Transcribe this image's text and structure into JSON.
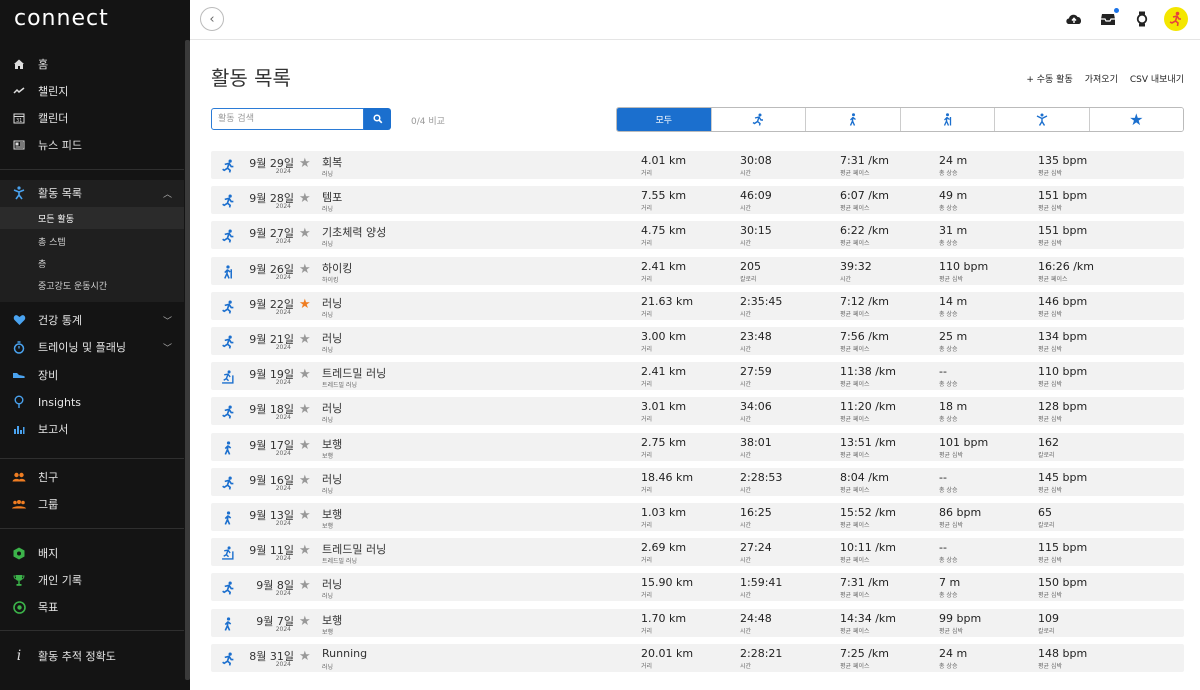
{
  "app": {
    "logo": "connect"
  },
  "sidebar": {
    "items": [
      {
        "label": "홈",
        "icon": "home-icon"
      },
      {
        "label": "챌린지",
        "icon": "challenge-icon"
      },
      {
        "label": "캘린더",
        "icon": "calendar-icon"
      },
      {
        "label": "뉴스 피드",
        "icon": "news-feed-icon"
      },
      {
        "label": "활동 목록",
        "icon": "activity-icon"
      },
      {
        "label": "건강 통계",
        "icon": "heart-icon"
      },
      {
        "label": "트레이닝 및 플래닝",
        "icon": "stopwatch-icon"
      },
      {
        "label": "장비",
        "icon": "shoe-icon"
      },
      {
        "label": "Insights",
        "icon": "lightbulb-icon"
      },
      {
        "label": "보고서",
        "icon": "report-icon"
      },
      {
        "label": "친구",
        "icon": "friends-icon"
      },
      {
        "label": "그룹",
        "icon": "groups-icon"
      },
      {
        "label": "배지",
        "icon": "badge-icon"
      },
      {
        "label": "개인 기록",
        "icon": "trophy-icon"
      },
      {
        "label": "목표",
        "icon": "goal-icon"
      },
      {
        "label": "활동 추적 정확도",
        "icon": "info-icon"
      }
    ],
    "subitems": [
      "모든 활동",
      "총 스텝",
      "층",
      "중고강도 운동시간"
    ]
  },
  "page": {
    "title": "활동 목록",
    "actions": [
      "+ 수동 활동",
      "가져오기",
      "CSV 내보내기"
    ],
    "search_placeholder": "활동 검색",
    "compare": "0/4 비교",
    "filters": [
      "모두",
      "",
      "",
      "",
      "",
      ""
    ]
  },
  "accent": "#1b6fce",
  "activities": [
    {
      "icon": "run",
      "date": "9월 29일",
      "year": "2024",
      "fav": false,
      "name": "회복",
      "type": "러닝",
      "stats": [
        [
          "4.01 km",
          "거리"
        ],
        [
          "30:08",
          "시간"
        ],
        [
          "7:31 /km",
          "평균 페이스"
        ],
        [
          "24 m",
          "총 상승"
        ],
        [
          "135 bpm",
          "평균 심박"
        ]
      ]
    },
    {
      "icon": "run",
      "date": "9월 28일",
      "year": "2024",
      "fav": false,
      "name": "템포",
      "type": "러닝",
      "stats": [
        [
          "7.55 km",
          "거리"
        ],
        [
          "46:09",
          "시간"
        ],
        [
          "6:07 /km",
          "평균 페이스"
        ],
        [
          "49 m",
          "총 상승"
        ],
        [
          "151 bpm",
          "평균 심박"
        ]
      ]
    },
    {
      "icon": "run",
      "date": "9월 27일",
      "year": "2024",
      "fav": false,
      "name": "기초체력 양성",
      "type": "러닝",
      "stats": [
        [
          "4.75 km",
          "거리"
        ],
        [
          "30:15",
          "시간"
        ],
        [
          "6:22 /km",
          "평균 페이스"
        ],
        [
          "31 m",
          "총 상승"
        ],
        [
          "151 bpm",
          "평균 심박"
        ]
      ]
    },
    {
      "icon": "hike",
      "date": "9월 26일",
      "year": "2024",
      "fav": false,
      "name": "하이킹",
      "type": "하이킹",
      "stats": [
        [
          "2.41 km",
          "거리"
        ],
        [
          "205",
          "칼로리"
        ],
        [
          "39:32",
          "시간"
        ],
        [
          "110 bpm",
          "평균 심박"
        ],
        [
          "16:26 /km",
          "평균 페이스"
        ]
      ]
    },
    {
      "icon": "run",
      "date": "9월 22일",
      "year": "2024",
      "fav": true,
      "name": "러닝",
      "type": "러닝",
      "stats": [
        [
          "21.63 km",
          "거리"
        ],
        [
          "2:35:45",
          "시간"
        ],
        [
          "7:12 /km",
          "평균 페이스"
        ],
        [
          "14 m",
          "총 상승"
        ],
        [
          "146 bpm",
          "평균 심박"
        ]
      ]
    },
    {
      "icon": "run",
      "date": "9월 21일",
      "year": "2024",
      "fav": false,
      "name": "러닝",
      "type": "러닝",
      "stats": [
        [
          "3.00 km",
          "거리"
        ],
        [
          "23:48",
          "시간"
        ],
        [
          "7:56 /km",
          "평균 페이스"
        ],
        [
          "25 m",
          "총 상승"
        ],
        [
          "134 bpm",
          "평균 심박"
        ]
      ]
    },
    {
      "icon": "treadmill",
      "date": "9월 19일",
      "year": "2024",
      "fav": false,
      "name": "트레드밀 러닝",
      "type": "트레드밀 러닝",
      "stats": [
        [
          "2.41 km",
          "거리"
        ],
        [
          "27:59",
          "시간"
        ],
        [
          "11:38 /km",
          "평균 페이스"
        ],
        [
          "--",
          "총 상승"
        ],
        [
          "110 bpm",
          "평균 심박"
        ]
      ]
    },
    {
      "icon": "run",
      "date": "9월 18일",
      "year": "2024",
      "fav": false,
      "name": "러닝",
      "type": "러닝",
      "stats": [
        [
          "3.01 km",
          "거리"
        ],
        [
          "34:06",
          "시간"
        ],
        [
          "11:20 /km",
          "평균 페이스"
        ],
        [
          "18 m",
          "총 상승"
        ],
        [
          "128 bpm",
          "평균 심박"
        ]
      ]
    },
    {
      "icon": "walk",
      "date": "9월 17일",
      "year": "2024",
      "fav": false,
      "name": "보행",
      "type": "보행",
      "stats": [
        [
          "2.75 km",
          "거리"
        ],
        [
          "38:01",
          "시간"
        ],
        [
          "13:51 /km",
          "평균 페이스"
        ],
        [
          "101 bpm",
          "평균 심박"
        ],
        [
          "162",
          "칼로리"
        ]
      ]
    },
    {
      "icon": "run",
      "date": "9월 16일",
      "year": "2024",
      "fav": false,
      "name": "러닝",
      "type": "러닝",
      "stats": [
        [
          "18.46 km",
          "거리"
        ],
        [
          "2:28:53",
          "시간"
        ],
        [
          "8:04 /km",
          "평균 페이스"
        ],
        [
          "--",
          "총 상승"
        ],
        [
          "145 bpm",
          "평균 심박"
        ]
      ]
    },
    {
      "icon": "walk",
      "date": "9월 13일",
      "year": "2024",
      "fav": false,
      "name": "보행",
      "type": "보행",
      "stats": [
        [
          "1.03 km",
          "거리"
        ],
        [
          "16:25",
          "시간"
        ],
        [
          "15:52 /km",
          "평균 페이스"
        ],
        [
          "86 bpm",
          "평균 심박"
        ],
        [
          "65",
          "칼로리"
        ]
      ]
    },
    {
      "icon": "treadmill",
      "date": "9월 11일",
      "year": "2024",
      "fav": false,
      "name": "트레드밀 러닝",
      "type": "트레드밀 러닝",
      "stats": [
        [
          "2.69 km",
          "거리"
        ],
        [
          "27:24",
          "시간"
        ],
        [
          "10:11 /km",
          "평균 페이스"
        ],
        [
          "--",
          "총 상승"
        ],
        [
          "115 bpm",
          "평균 심박"
        ]
      ]
    },
    {
      "icon": "run",
      "date": "9월 8일",
      "year": "2024",
      "fav": false,
      "name": "러닝",
      "type": "러닝",
      "stats": [
        [
          "15.90 km",
          "거리"
        ],
        [
          "1:59:41",
          "시간"
        ],
        [
          "7:31 /km",
          "평균 페이스"
        ],
        [
          "7 m",
          "총 상승"
        ],
        [
          "150 bpm",
          "평균 심박"
        ]
      ]
    },
    {
      "icon": "walk",
      "date": "9월 7일",
      "year": "2024",
      "fav": false,
      "name": "보행",
      "type": "보행",
      "stats": [
        [
          "1.70 km",
          "거리"
        ],
        [
          "24:48",
          "시간"
        ],
        [
          "14:34 /km",
          "평균 페이스"
        ],
        [
          "99 bpm",
          "평균 심박"
        ],
        [
          "109",
          "칼로리"
        ]
      ]
    },
    {
      "icon": "run",
      "date": "8월 31일",
      "year": "2024",
      "fav": false,
      "name": "Running",
      "type": "러닝",
      "stats": [
        [
          "20.01 km",
          "거리"
        ],
        [
          "2:28:21",
          "시간"
        ],
        [
          "7:25 /km",
          "평균 페이스"
        ],
        [
          "24 m",
          "총 상승"
        ],
        [
          "148 bpm",
          "평균 심박"
        ]
      ]
    }
  ]
}
